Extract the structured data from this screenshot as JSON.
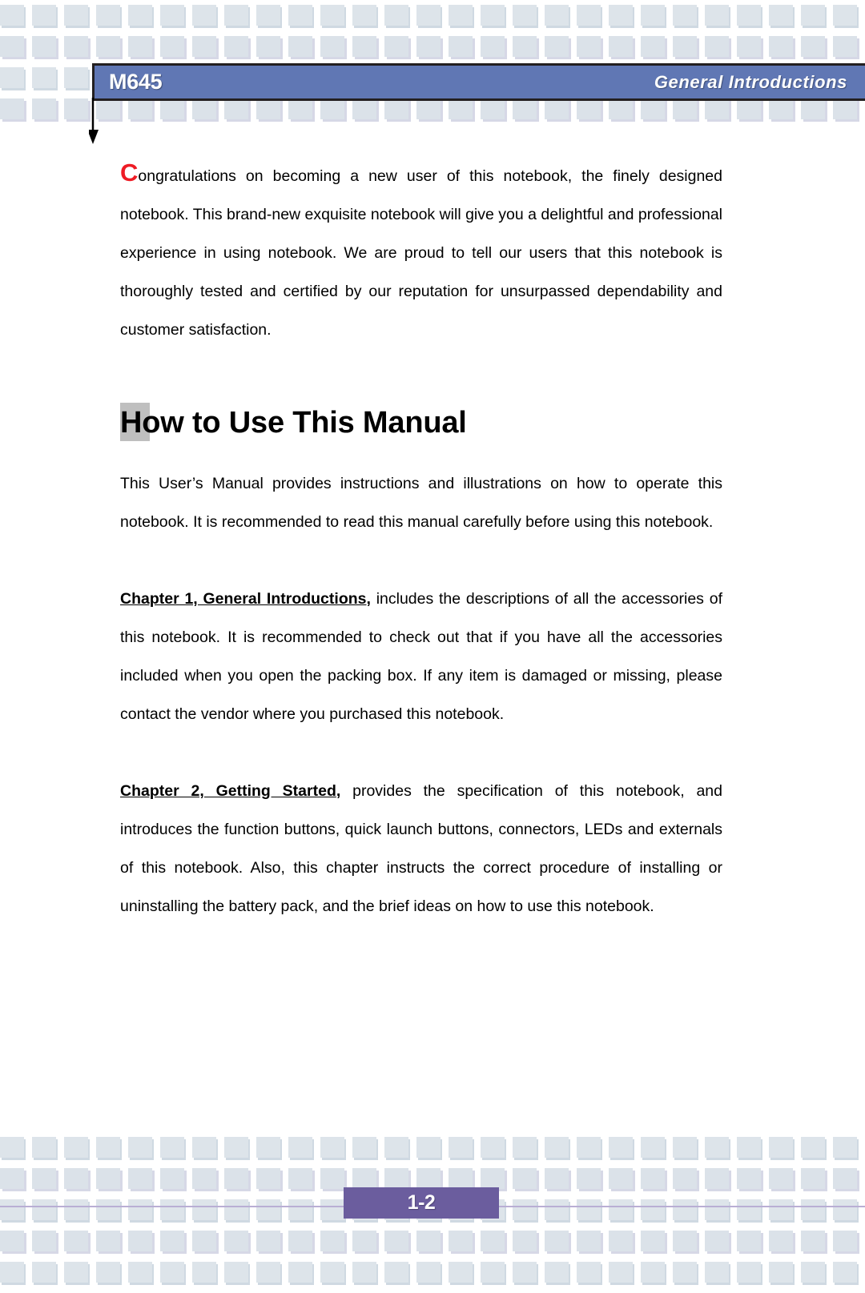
{
  "header": {
    "model": "M645",
    "section_title": "General  Introductions",
    "bar_color": "#6077B4",
    "border_color": "#231F20"
  },
  "intro": {
    "dropcap": "C",
    "text": "ongratulations on becoming a new user of this notebook, the finely designed notebook.   This brand-new exquisite notebook will give you a delightful and professional experience in using notebook.   We are proud to tell our users that this notebook is thoroughly tested and certified by our reputation for unsurpassed dependability and customer satisfaction.",
    "dropcap_color": "#EE1C25"
  },
  "section": {
    "heading": "How to Use This Manual",
    "block_color": "#BFBFBF"
  },
  "body": {
    "paragraph_1": "This User’s Manual provides instructions and illustrations on how to operate this notebook.   It is recommended to read this manual carefully before using this notebook.",
    "chapter_1": {
      "ref": "Chapter 1, General Introductions",
      "comma": ",",
      "text": " includes the descriptions of all the accessories of this notebook.   It is recommended to check out that if you have all the accessories included when you open the packing box.   If any item is damaged or missing, please contact the vendor where you purchased this notebook."
    },
    "chapter_2": {
      "ref": "Chapter 2, Getting Started",
      "comma": ",",
      "text": " provides the specification of this notebook, and introduces the function buttons, quick launch buttons, connectors, LEDs and externals of this notebook.   Also, this chapter instructs the correct procedure of installing or uninstalling the battery pack, and the brief ideas on how to use this notebook."
    }
  },
  "footer": {
    "page_number": "1-2",
    "badge_color": "#6B5D9E",
    "rule_color": "#B9AED4"
  },
  "decoration": {
    "tile_color": "#DDE4EA",
    "tile_shadow_color": "#A8BACB",
    "top_rows": 4,
    "bottom_rows": 5,
    "tiles_per_row": 28
  }
}
